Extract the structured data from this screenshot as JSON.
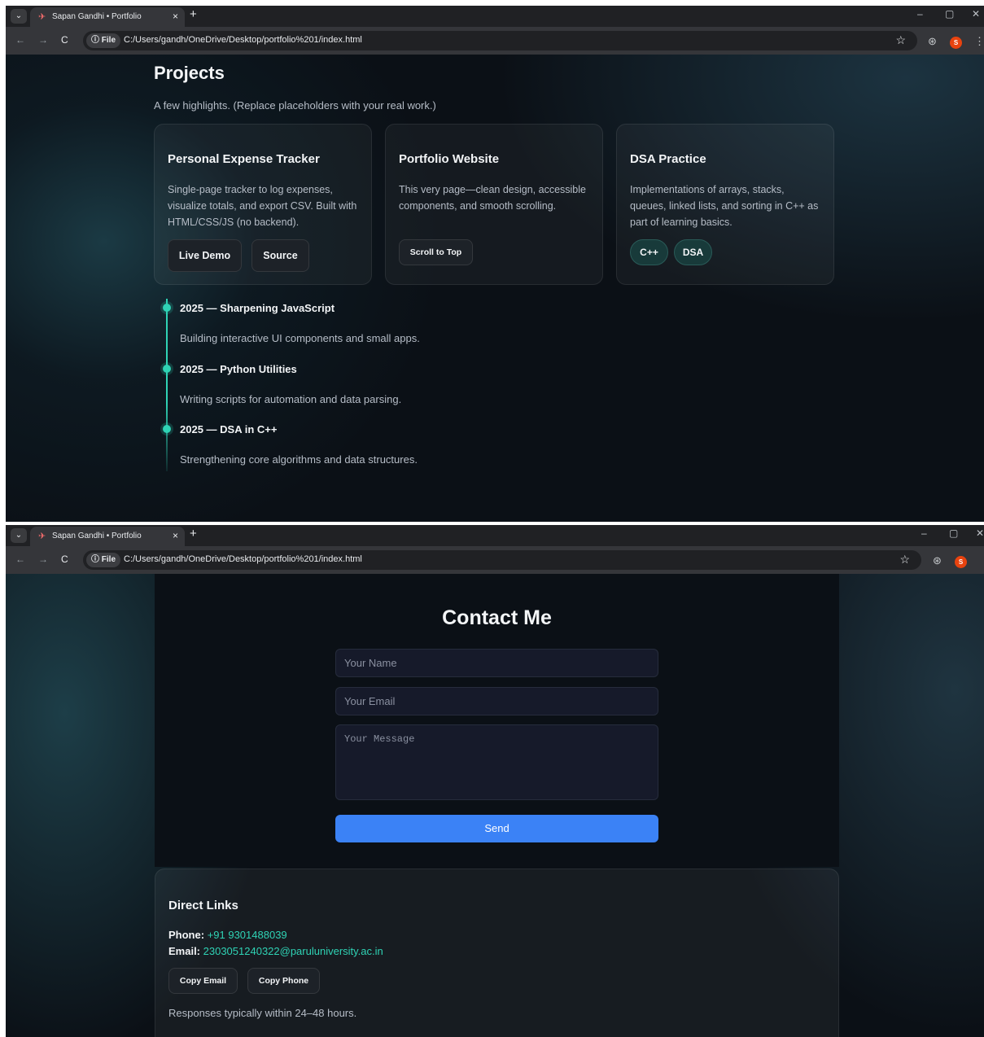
{
  "browser": {
    "tab_title": "Sapan Gandhi • Portfolio",
    "tab_close": "×",
    "new_tab": "+",
    "address_chip": "ⓘ File",
    "url": "C:/Users/gandh/OneDrive/Desktop/portfolio%201/index.html",
    "avatar_letter": "S",
    "window_controls": [
      "–",
      "▢",
      "✕"
    ],
    "nav": [
      "←",
      "→",
      "C"
    ]
  },
  "projects": {
    "title": "Projects",
    "subtitle": "A few highlights. (Replace placeholders with your real work.)",
    "cards": [
      {
        "title": "Personal Expense Tracker",
        "description": "Single-page tracker to log expenses, visualize totals, and export CSV. Built with HTML/CSS/JS (no backend).",
        "buttons": [
          "Live Demo",
          "Source"
        ]
      },
      {
        "title": "Portfolio Website",
        "description": "This very page—clean design, accessible components, and smooth scrolling.",
        "buttons": [
          "Scroll to Top"
        ]
      },
      {
        "title": "DSA Practice",
        "description": "Implementations of arrays, stacks, queues, linked lists, and sorting in C++ as part of learning basics.",
        "tags": [
          "C++",
          "DSA"
        ]
      }
    ]
  },
  "timeline": [
    {
      "heading": "2025 — Sharpening JavaScript",
      "description": "Building interactive UI components and small apps."
    },
    {
      "heading": "2025 — Python Utilities",
      "description": "Writing scripts for automation and data parsing."
    },
    {
      "heading": "2025 — DSA in C++",
      "description": "Strengthening core algorithms and data structures."
    }
  ],
  "contact": {
    "title": "Contact Me",
    "name_placeholder": "Your Name",
    "email_placeholder": "Your Email",
    "message_placeholder": "Your Message",
    "send_label": "Send"
  },
  "direct_links": {
    "title": "Direct Links",
    "phone_label": "Phone:",
    "phone_value": "+91 9301488039",
    "email_label": "Email:",
    "email_value": "2303051240322@paruluniversity.ac.in",
    "copy_email": "Copy Email",
    "copy_phone": "Copy Phone",
    "note": "Responses typically within 24–48 hours."
  },
  "colors": {
    "accent": "#2fd3b5",
    "send_button": "#3b82f6",
    "background": "#0b1016"
  }
}
